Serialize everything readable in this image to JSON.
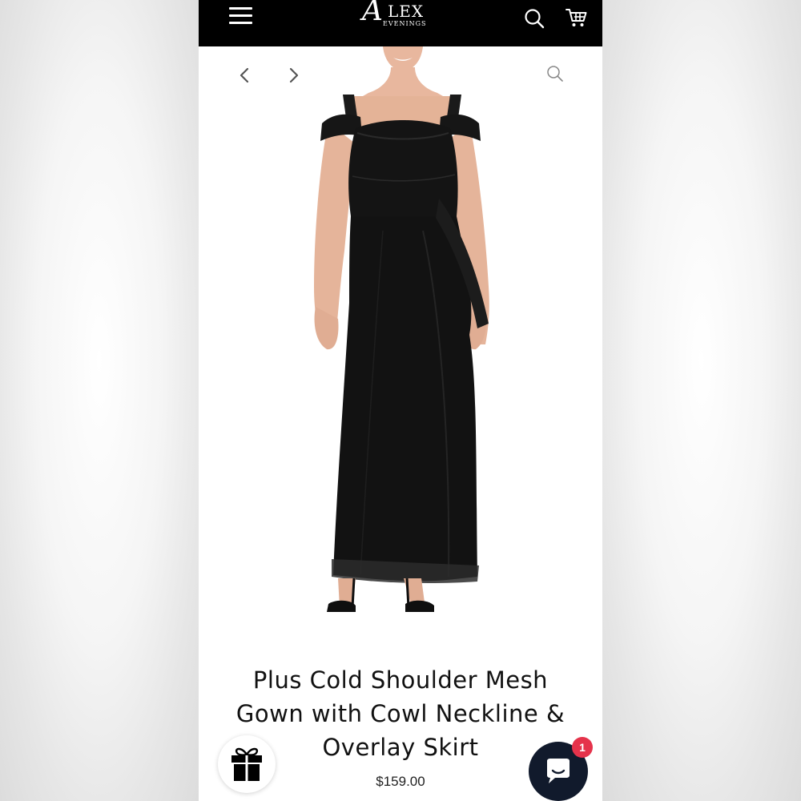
{
  "brand": {
    "logo_initial": "A",
    "logo_rest": "LEX",
    "logo_sub": "EVENINGS"
  },
  "header": {
    "menu_icon": "hamburger-menu-icon",
    "search_icon": "search-icon",
    "cart_icon": "cart-icon"
  },
  "gallery": {
    "prev_icon": "chevron-left-icon",
    "next_icon": "chevron-right-icon",
    "zoom_icon": "zoom-search-icon"
  },
  "product": {
    "title": "Plus Cold Shoulder Mesh Gown with Cowl Neckline & Overlay Skirt",
    "price": "$159.00"
  },
  "widgets": {
    "gift_icon": "gift-icon",
    "chat_icon": "chat-bubble-icon",
    "chat_badge": "1"
  },
  "colors": {
    "header_bg": "#000000",
    "chat_bg": "#111a2c",
    "badge": "#e5334b"
  }
}
